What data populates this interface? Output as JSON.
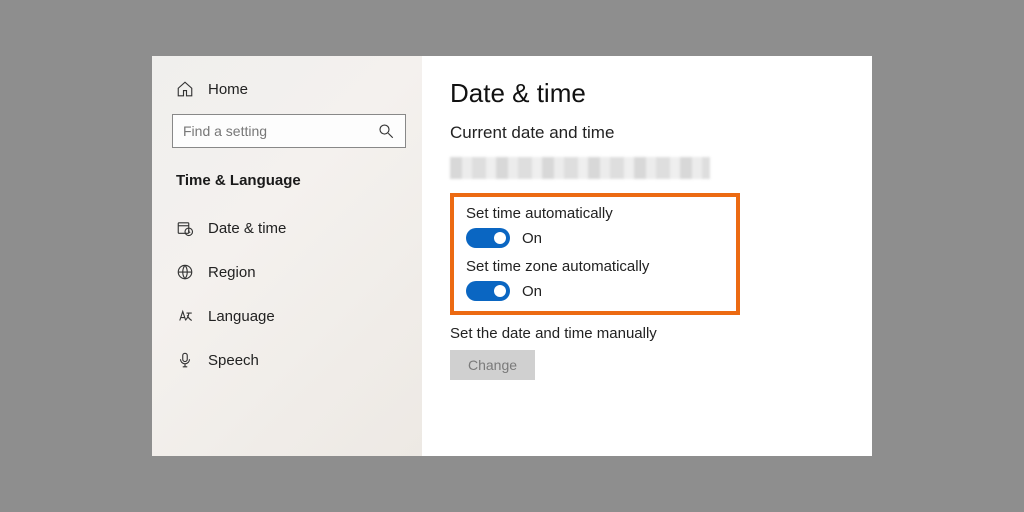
{
  "sidebar": {
    "home_label": "Home",
    "search_placeholder": "Find a setting",
    "category_header": "Time & Language",
    "items": [
      {
        "label": "Date & time"
      },
      {
        "label": "Region"
      },
      {
        "label": "Language"
      },
      {
        "label": "Speech"
      }
    ]
  },
  "content": {
    "title": "Date & time",
    "section_title": "Current date and time",
    "settings": {
      "set_time_auto": {
        "label": "Set time automatically",
        "state": "On"
      },
      "set_zone_auto": {
        "label": "Set time zone automatically",
        "state": "On"
      },
      "manual": {
        "label": "Set the date and time manually",
        "button": "Change"
      }
    },
    "highlight_color": "#ec6a12",
    "accent_color": "#0a66c2"
  }
}
